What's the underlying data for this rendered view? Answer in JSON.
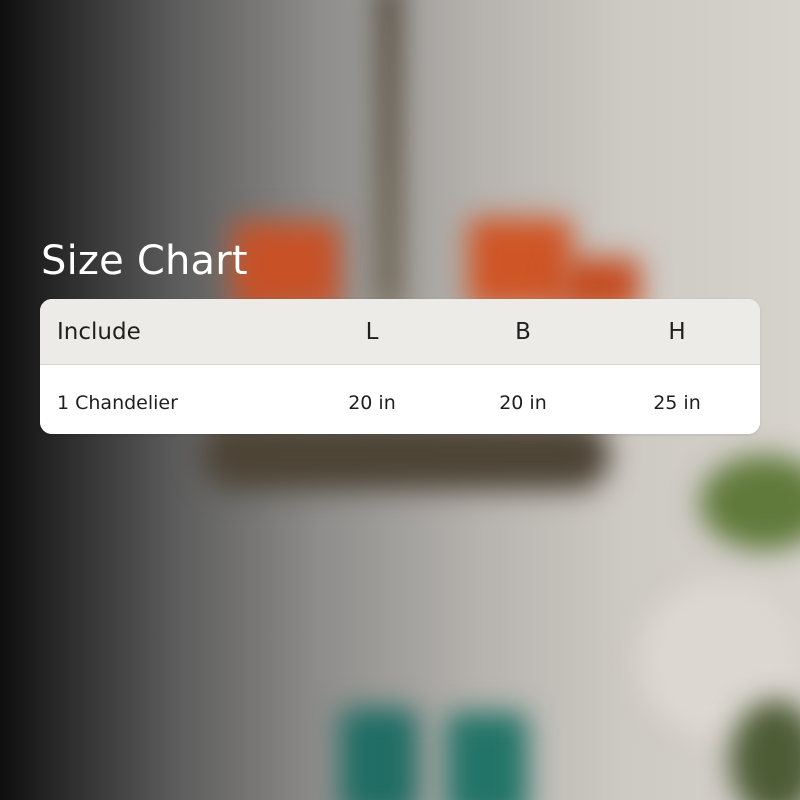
{
  "title": "Size Chart",
  "table": {
    "headers": [
      "Include",
      "L",
      "B",
      "H"
    ],
    "rows": [
      [
        "1 Chandelier",
        "20 in",
        "20 in",
        "25 in"
      ]
    ]
  },
  "colors": {
    "title_text": "#ffffff",
    "header_background": "#edebe7",
    "body_background": "#ffffff",
    "cell_text": "#1f1f1f"
  }
}
